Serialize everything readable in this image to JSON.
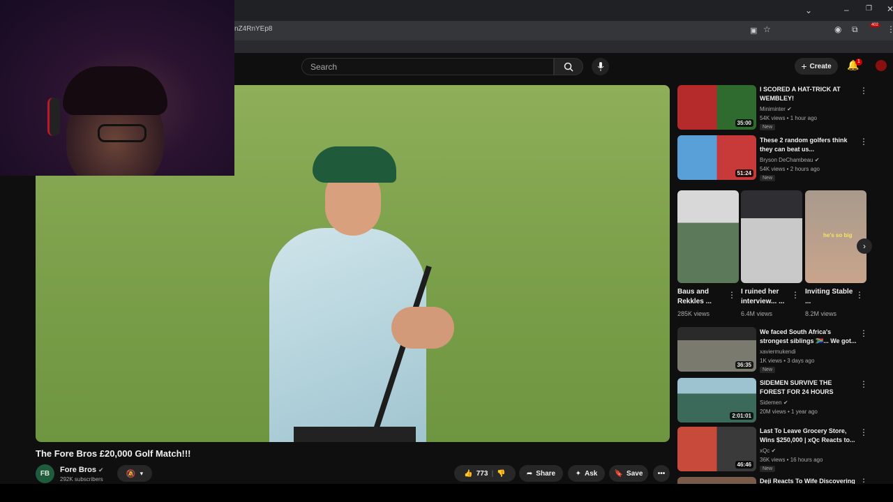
{
  "browser": {
    "url_fragment": "nZ4RnYEp8",
    "ext_badge": "402",
    "icons": [
      "chevron-down-icon",
      "minimize-icon",
      "restore-icon",
      "close-icon",
      "reader-icon",
      "star-icon",
      "profile-icon",
      "extensions-icon",
      "menu-icon"
    ]
  },
  "header": {
    "search_placeholder": "Search",
    "create_label": "Create",
    "notifications_count": "1"
  },
  "video": {
    "title": "The Fore Bros £20,000 Golf Match!!!",
    "channel_name": "Fore Bros",
    "channel_initials": "FB",
    "subscribers": "292K subscribers",
    "likes": "773",
    "share_label": "Share",
    "ask_label": "Ask",
    "save_label": "Save"
  },
  "sidebar": {
    "videos_top": [
      {
        "title": "I SCORED A HAT-TRICK AT WEMBLEY!",
        "channel": "Miniminter",
        "views": "54K views • 1 hour ago",
        "duration": "35:00",
        "badge": "New",
        "thumb_color": "#b52a2a"
      },
      {
        "title": "These 2 random golfers think they can beat us...",
        "channel": "Bryson DeChambeau",
        "views": "54K views • 2 hours ago",
        "duration": "51:24",
        "badge": "New",
        "thumb_color": "#3a7bc8"
      }
    ],
    "shorts": [
      {
        "title": "Baus and Rekkles ...",
        "views": "285K views",
        "thumb_color": "#5c6b7d"
      },
      {
        "title": "I ruined her interview... ...",
        "views": "6.4M views",
        "thumb_color": "#4a4f57"
      },
      {
        "title": "Inviting Stable ...",
        "views": "8.2M views",
        "caption": "he's so big",
        "thumb_color": "#8d7b6c"
      }
    ],
    "videos_bottom": [
      {
        "title": "We faced South Africa's strongest siblings 🇿🇦... We got...",
        "channel": "xaviermukendi",
        "views": "1K views • 3 days ago",
        "duration": "36:35",
        "badge": "New",
        "thumb_color": "#6e6e64"
      },
      {
        "title": "SIDEMEN SURVIVE THE FOREST FOR 24 HOURS",
        "channel": "Sidemen",
        "views": "20M views • 1 year ago",
        "duration": "2:01:01",
        "badge": "",
        "thumb_color": "#4f7a86"
      },
      {
        "title": "Last To Leave Grocery Store, Wins $250,000 | xQc Reacts to...",
        "channel": "xQc",
        "views": "36K views • 16 hours ago",
        "duration": "46:46",
        "badge": "New",
        "thumb_color": "#a8453b"
      },
      {
        "title": "Deji Reacts To Wife Discovering",
        "channel": "",
        "views": "",
        "duration": "",
        "badge": "",
        "thumb_color": "#7a5a4a"
      }
    ]
  }
}
